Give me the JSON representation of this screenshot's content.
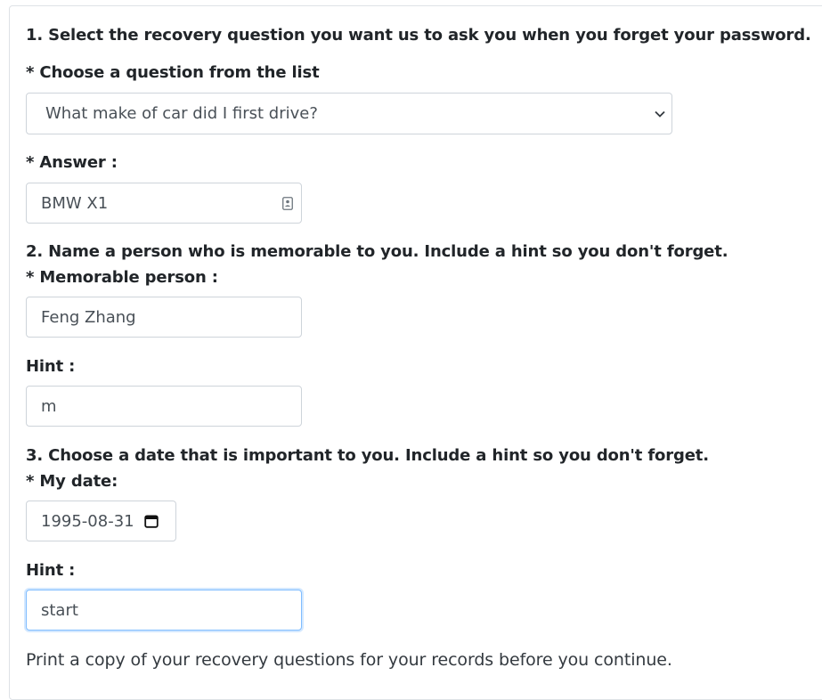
{
  "section1": {
    "heading": "1. Select the recovery question you want us to ask you when you forget your password.",
    "question_label": "* Choose a question from the list",
    "question_selected": "What make of car did I first drive?",
    "answer_label": "* Answer :",
    "answer_value": "BMW X1"
  },
  "section2": {
    "heading": "2. Name a person who is memorable to you. Include a hint so you don't forget.",
    "person_label": "* Memorable person :",
    "person_value": "Feng Zhang",
    "hint_label": "Hint :",
    "hint_value": "m"
  },
  "section3": {
    "heading": "3. Choose a date that is important to you. Include a hint so you don't forget.",
    "date_label": "* My date:",
    "date_value": "1995-08-31",
    "hint_label": "Hint :",
    "hint_value": "start"
  },
  "footer": {
    "note": "Print a copy of your recovery questions for your records before you continue."
  },
  "icons": {
    "select": "chevron-down-icon",
    "answer_field": "contact-card-icon",
    "date_field": "calendar-icon"
  },
  "colors": {
    "border": "#ced4da",
    "focus_border": "#80bdff",
    "text": "#212529"
  }
}
